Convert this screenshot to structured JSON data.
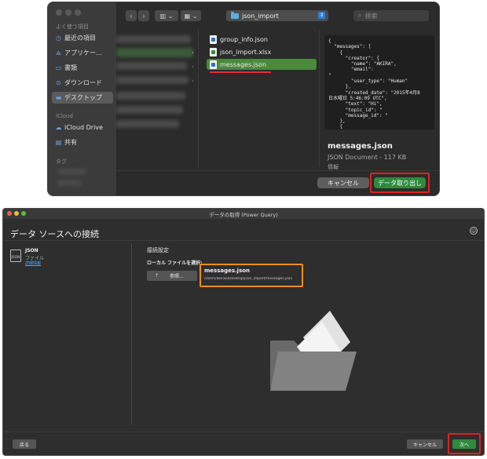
{
  "picker": {
    "sidebar": {
      "favorites_header": "よく使う項目",
      "items": [
        {
          "label": "最近の項目",
          "icon": "clock-icon"
        },
        {
          "label": "アプリケー…",
          "icon": "apps-icon"
        },
        {
          "label": "書類",
          "icon": "document-icon"
        },
        {
          "label": "ダウンロード",
          "icon": "download-icon"
        },
        {
          "label": "デスクトップ",
          "icon": "desktop-icon"
        }
      ],
      "icloud_header": "iCloud",
      "icloud_items": [
        {
          "label": "iCloud Drive",
          "icon": "cloud-icon"
        },
        {
          "label": "共有",
          "icon": "shared-folder-icon"
        }
      ],
      "tags_header": "タグ"
    },
    "location": "json_import",
    "search_placeholder": "検索",
    "files": [
      {
        "name": "group_info.json",
        "type": "json"
      },
      {
        "name": "json_import.xlsx",
        "type": "xlsx"
      },
      {
        "name": "messages.json",
        "type": "json",
        "selected": true
      }
    ],
    "preview": {
      "code": "{\n  \"messages\": [\n    {\n      \"creator\": {\n        \"name\": \"AKIRA\",\n        \"email\":\n\"\n        \"user_type\": \"Human\"\n      },\n      \"created_date\": \"2015年4月8\n日水曜日 5:46:09 UTC\",\n      \"text\": \"Hi\",\n      \"topic_id\": \"\n      \"message_id\": \"\n    },\n    {",
      "filename": "messages.json",
      "meta": "JSON Document - 117 KB",
      "cut": "情報"
    },
    "cancel_label": "キャンセル",
    "open_label": "データ取り出し"
  },
  "pq": {
    "title": "データの取得 (Power Query)",
    "heading": "データ ソースへの接続",
    "source": {
      "icon_text": "JSON",
      "name": "JSON",
      "kind": "ファイル",
      "details_link": "詳細情報"
    },
    "section_title": "接続設定",
    "local_label": "ローカル ファイルを選択:",
    "browse_label": "参照...",
    "file_name": "messages.json",
    "file_path": "/Users/akirao/Desktop/json_import/messages.json",
    "back_label": "戻る",
    "cancel_label": "キャンセル",
    "next_label": "次へ"
  },
  "colors": {
    "accent_green": "#2f8a3d",
    "highlight_red": "#e02020",
    "highlight_orange": "#ef8c1a",
    "folder_blue": "#5aaee8"
  }
}
